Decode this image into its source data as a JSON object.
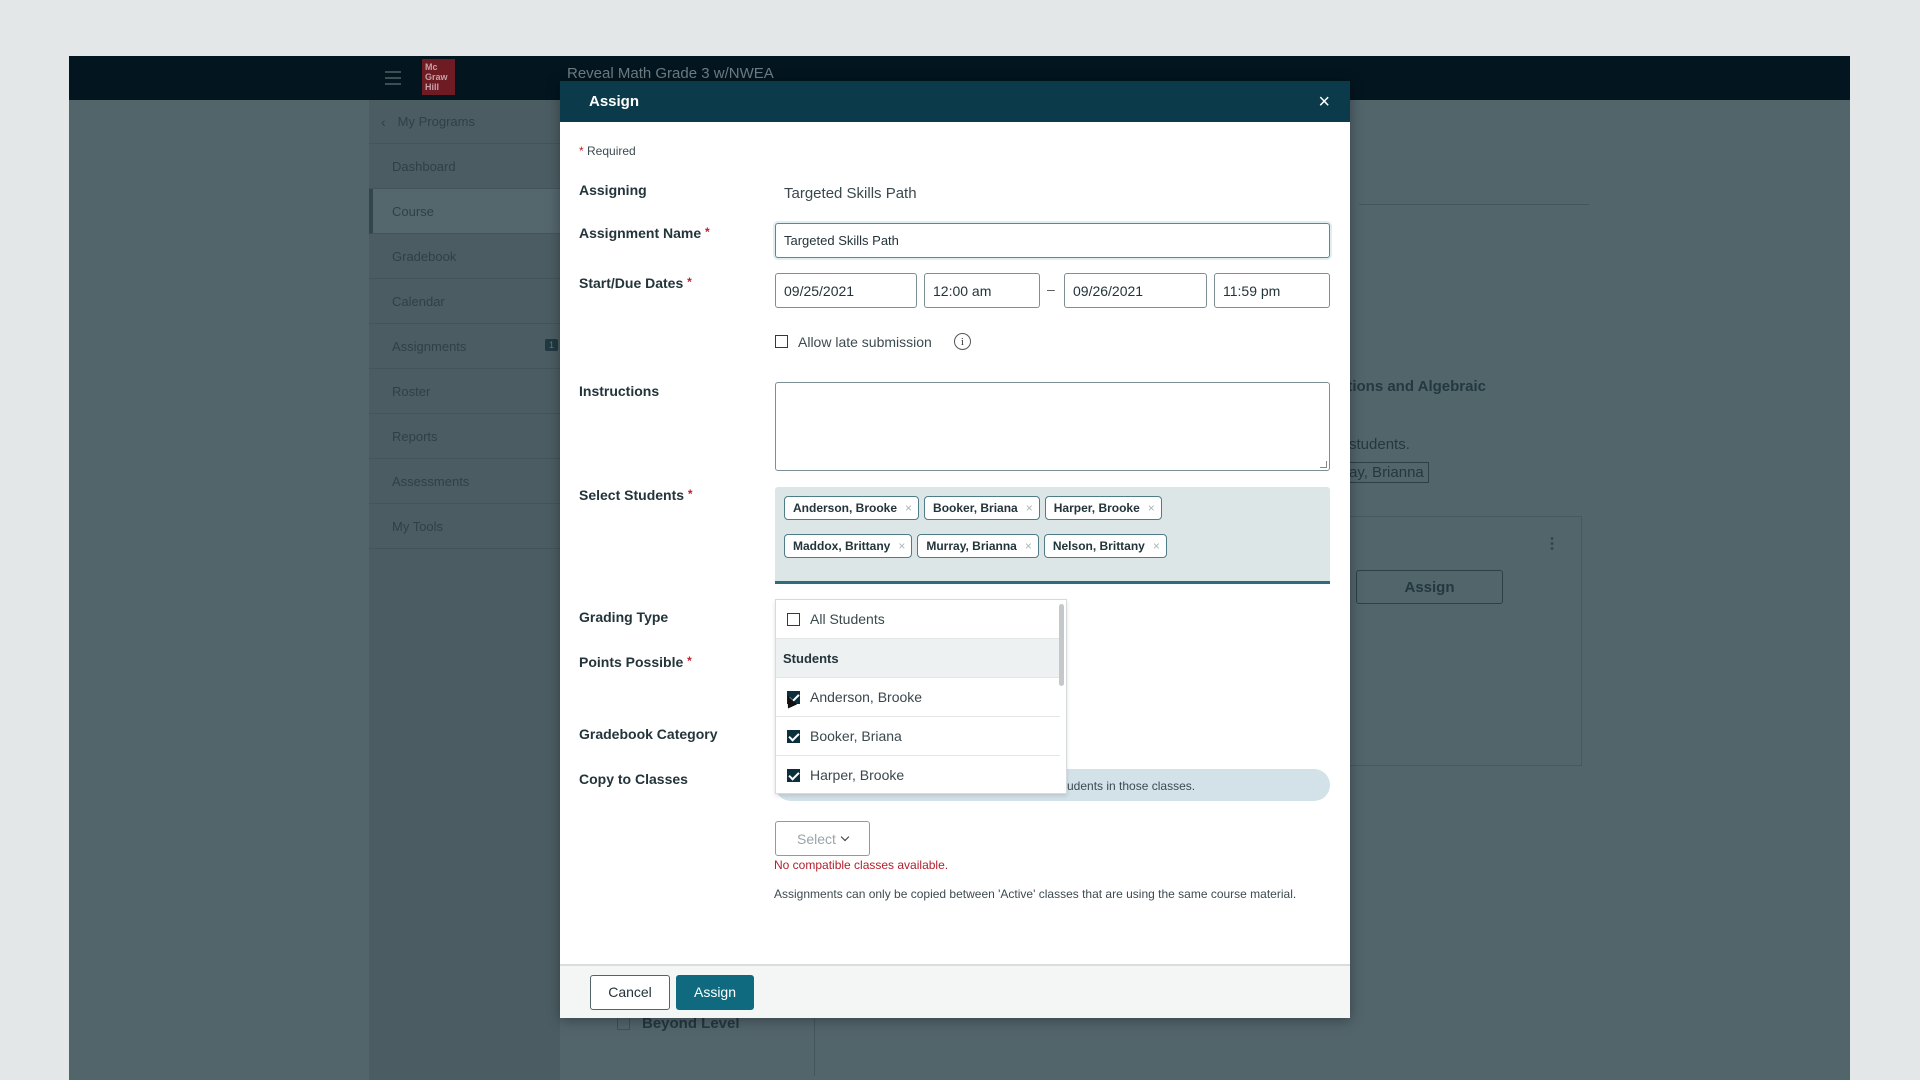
{
  "app": {
    "title": "Reveal Math Grade 3 w/NWEA",
    "logo_text": "Mc Graw Hill"
  },
  "sidebar": {
    "back_label": "My Programs",
    "items": [
      {
        "label": "Dashboard"
      },
      {
        "label": "Course",
        "active": true
      },
      {
        "label": "Gradebook"
      },
      {
        "label": "Calendar"
      },
      {
        "label": "Assignments",
        "badge": "1"
      },
      {
        "label": "Roster"
      },
      {
        "label": "Reports"
      },
      {
        "label": "Assessments"
      },
      {
        "label": "My Tools"
      }
    ]
  },
  "background": {
    "heading": "ations and Algebraic",
    "text": "students.",
    "chip": "ray, Brianna",
    "card_assign_label": "Assign",
    "level_option": "Beyond Level"
  },
  "modal": {
    "title": "Assign",
    "close_label": "×",
    "required_note": "Required",
    "required_mark": "*",
    "labels": {
      "assigning": "Assigning",
      "assignment_name": "Assignment Name",
      "start_due": "Start/Due Dates",
      "instructions": "Instructions",
      "select_students": "Select Students",
      "grading_type": "Grading Type",
      "points_possible": "Points Possible",
      "gradebook_category": "Gradebook Category",
      "copy_to_classes": "Copy to Classes"
    },
    "assigning_value": "Targeted Skills Path",
    "assignment_name_value": "Targeted Skills Path",
    "start_date": "09/25/2021",
    "start_time": "12:00 am",
    "date_separator": "–",
    "due_date": "09/26/2021",
    "due_time": "11:59 pm",
    "allow_late_label": "Allow late submission",
    "allow_late_checked": false,
    "instructions_value": "",
    "selected_students": [
      "Anderson, Brooke",
      "Booker, Briana",
      "Harper, Brooke",
      "Maddox, Brittany",
      "Murray, Brianna",
      "Nelson, Brittany"
    ],
    "chip_remove": "×",
    "student_dropdown": {
      "all_label": "All Students",
      "all_checked": false,
      "group_label": "Students",
      "options": [
        {
          "label": "Anderson, Brooke",
          "checked": true
        },
        {
          "label": "Booker, Briana",
          "checked": true
        },
        {
          "label": "Harper, Brooke",
          "checked": true
        }
      ]
    },
    "copy_banner_text": "udents in those classes.",
    "copy_select_label": "Select",
    "copy_error": "No compatible classes available.",
    "copy_help": "Assignments can only be copied between 'Active' classes that are using the same course material.",
    "cancel_label": "Cancel",
    "assign_label": "Assign"
  },
  "colors": {
    "header": "#0b3b4b",
    "primary_button": "#0f6a80",
    "error": "#b3202c",
    "overlay": "#52656b"
  }
}
